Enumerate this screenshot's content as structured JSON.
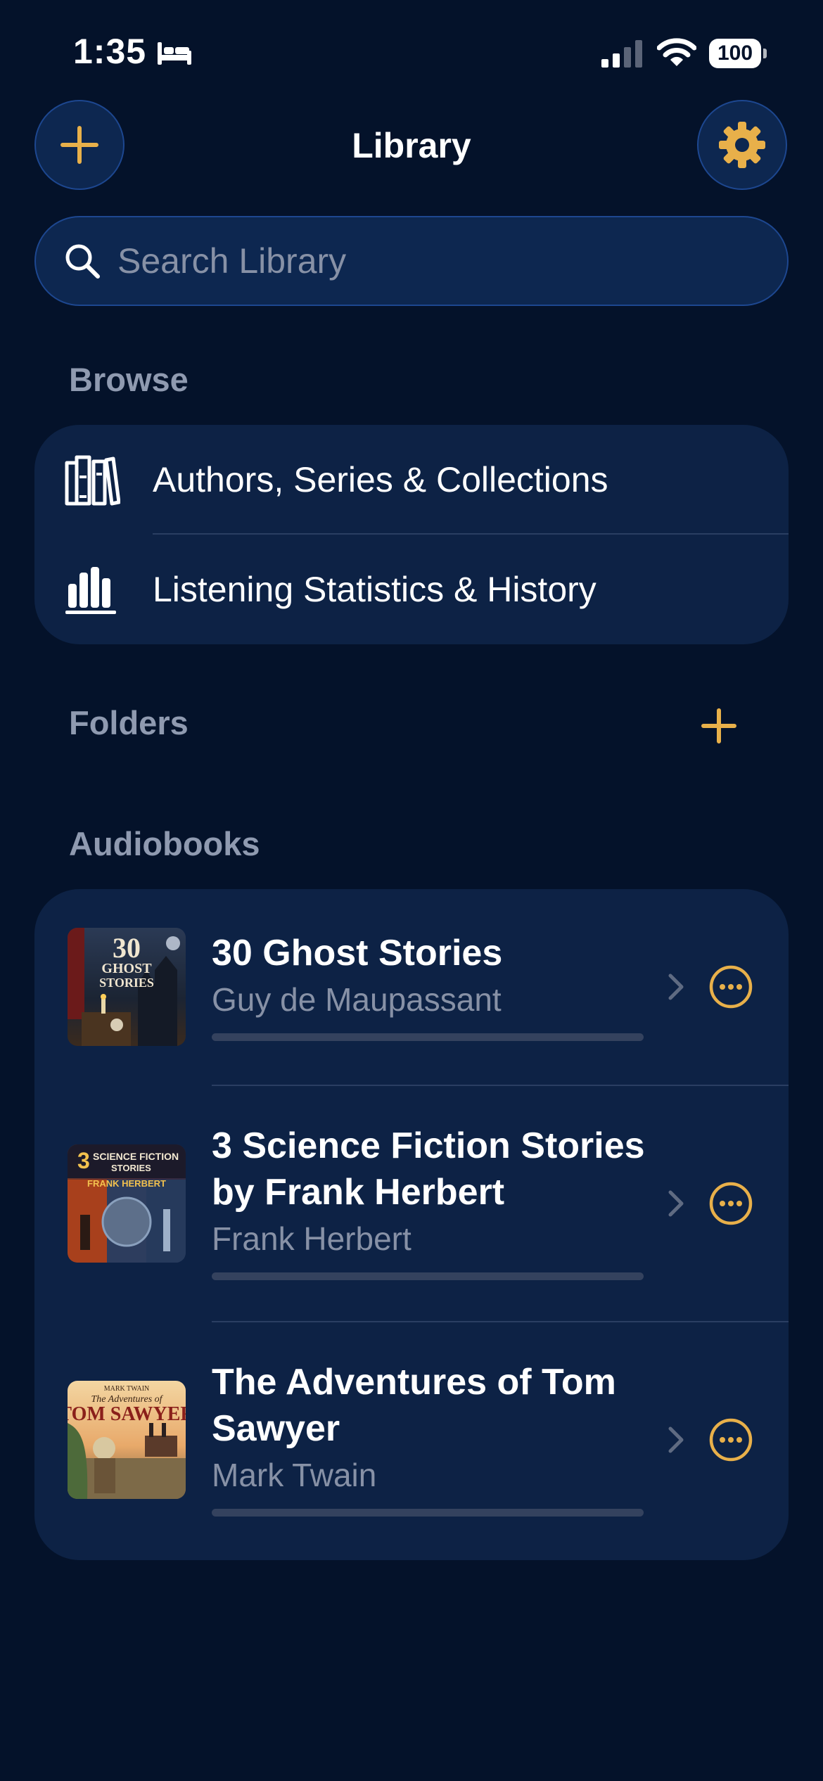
{
  "status_bar": {
    "time": "1:35",
    "battery": "100",
    "icons": [
      "bed-icon",
      "cellular-signal-icon",
      "wifi-icon",
      "battery-icon"
    ]
  },
  "header": {
    "title": "Library",
    "add_icon": "plus-icon",
    "settings_icon": "gear-icon"
  },
  "search": {
    "placeholder": "Search Library",
    "value": ""
  },
  "browse": {
    "header": "Browse",
    "items": [
      {
        "label": "Authors, Series & Collections",
        "icon": "books-icon"
      },
      {
        "label": "Listening Statistics & History",
        "icon": "bar-chart-icon"
      }
    ]
  },
  "folders": {
    "header": "Folders",
    "add_icon": "plus-icon"
  },
  "audiobooks": {
    "header": "Audiobooks",
    "items": [
      {
        "title": "30 Ghost Stories",
        "author": "Guy de Maupassant",
        "progress": 0,
        "cover_text": [
          "30",
          "GHOST",
          "STORIES"
        ]
      },
      {
        "title": "3 Science Fiction Stories by Frank Herbert",
        "author": "Frank Herbert",
        "progress": 0,
        "cover_text": [
          "3",
          "SCIENCE FICTION",
          "STORIES",
          "FRANK HERBERT"
        ]
      },
      {
        "title": "The Adventures of Tom Sawyer",
        "author": "Mark Twain",
        "progress": 0,
        "cover_text": [
          "MARK TWAIN",
          "The Adventures of",
          "TOM SAWYER"
        ]
      }
    ]
  },
  "colors": {
    "background": "#04122a",
    "card": "#0d2245",
    "accent": "#e8b04a",
    "secondary_text": "#8791a6",
    "section_header": "#8f9ab0"
  }
}
